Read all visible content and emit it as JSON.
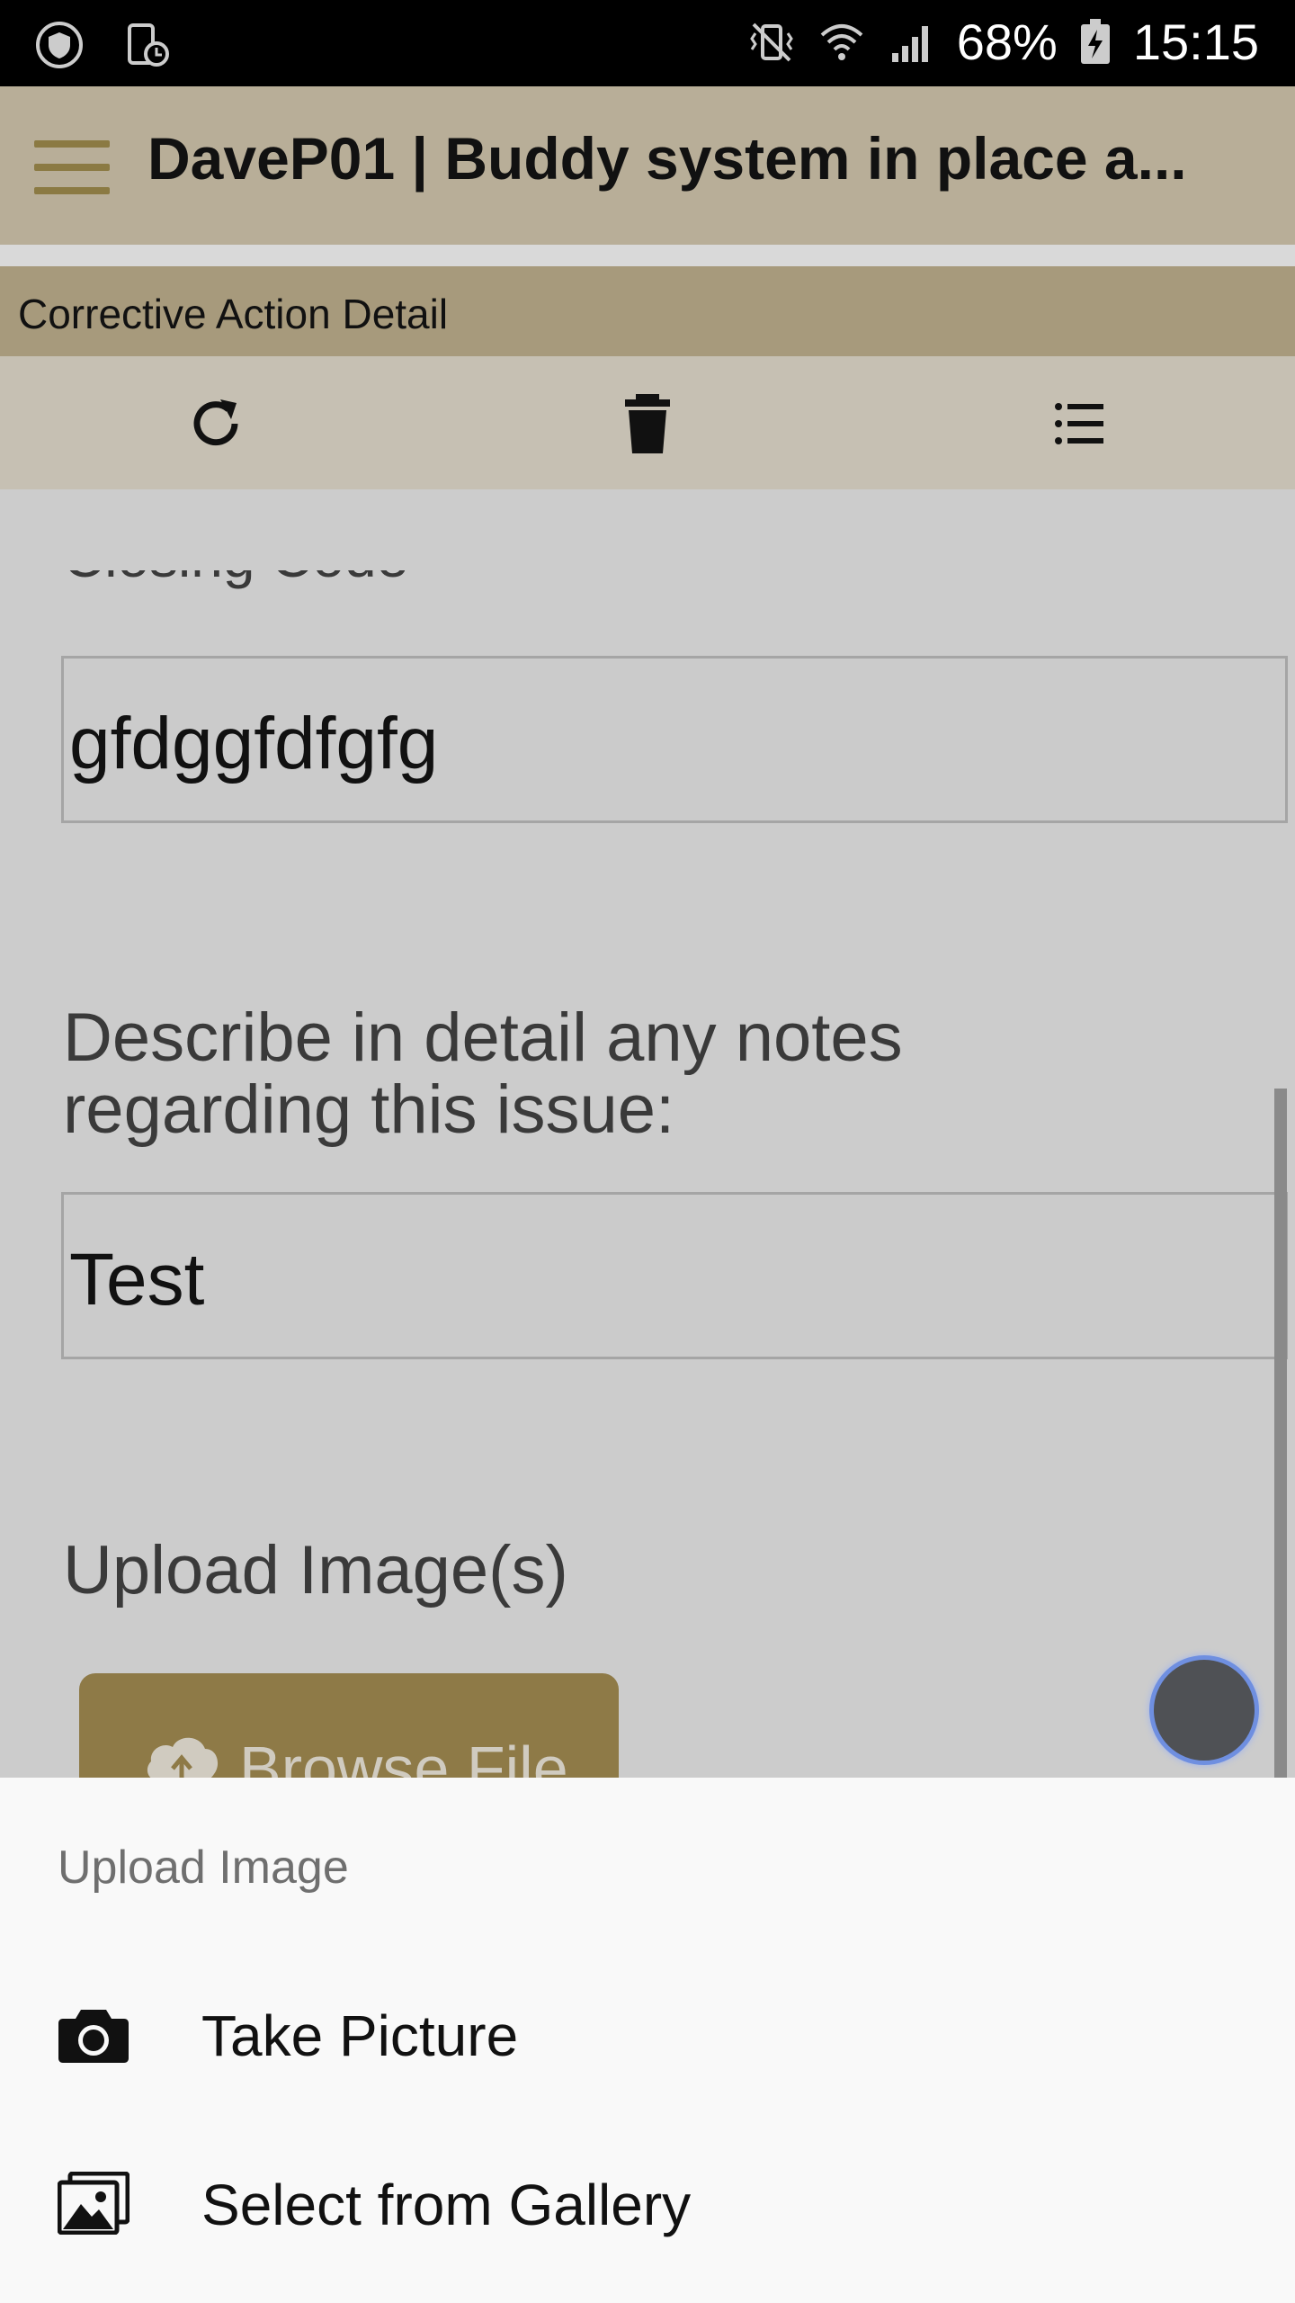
{
  "status_bar": {
    "battery": "68%",
    "time": "15:15",
    "icons": [
      "shield-icon",
      "device-clock-icon",
      "vibrate-off-icon",
      "wifi-icon",
      "signal-icon",
      "battery-icon"
    ]
  },
  "app_bar": {
    "title": "DaveP01 | Buddy system in place a...",
    "menu_icon": "hamburger-menu-icon"
  },
  "section": {
    "title": "Corrective Action Detail"
  },
  "toolbar": {
    "buttons": [
      "refresh-icon",
      "delete-icon",
      "list-icon"
    ]
  },
  "form": {
    "partial_label": "Closing Code",
    "field1_value": "gfdggfdfgfg",
    "notes_question": "Describe in detail any notes regarding this issue:",
    "notes_value": "Test",
    "upload_label": "Upload Image(s)",
    "browse_button": "Browse File"
  },
  "bottom_sheet": {
    "title": "Upload Image",
    "items": [
      {
        "label": "Take Picture",
        "icon": "camera-icon"
      },
      {
        "label": "Select from Gallery",
        "icon": "gallery-icon"
      }
    ]
  },
  "colors": {
    "app_bar": "#b8ae98",
    "section_header": "#a79a7c",
    "toolbar": "#c6c0b3",
    "accent_gold": "#8e7a47"
  }
}
